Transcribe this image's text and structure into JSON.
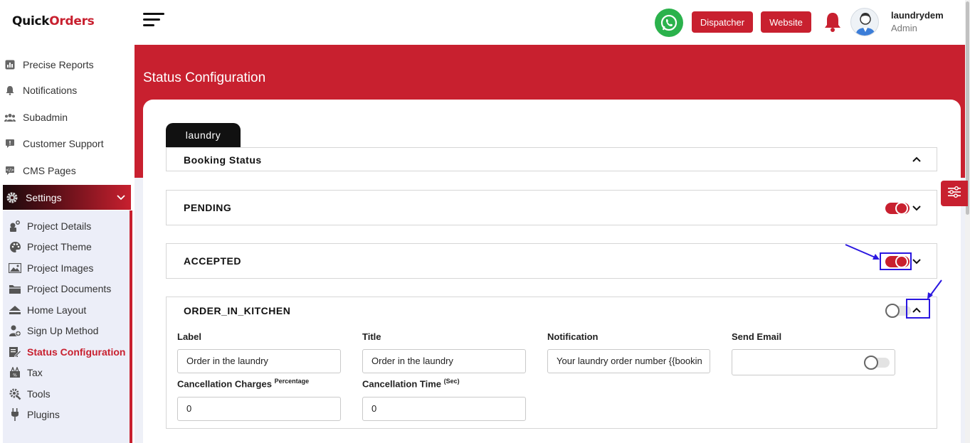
{
  "brand": {
    "logo_part1": "Quick",
    "logo_part2": "Orders"
  },
  "sidebar": {
    "items": [
      {
        "label": "Precise Reports",
        "icon": "chart-icon"
      },
      {
        "label": "Notifications",
        "icon": "bell-icon"
      },
      {
        "label": "Subadmin",
        "icon": "users-icon"
      },
      {
        "label": "Customer Support",
        "icon": "support-chat-icon"
      },
      {
        "label": "CMS Pages",
        "icon": "cms-chat-icon"
      }
    ],
    "settings_label": "Settings",
    "settings_expanded": true,
    "submenu": [
      {
        "label": "Project Details",
        "icon": "project-details-icon",
        "active": false
      },
      {
        "label": "Project Theme",
        "icon": "palette-icon",
        "active": false
      },
      {
        "label": "Project Images",
        "icon": "image-icon",
        "active": false
      },
      {
        "label": "Project Documents",
        "icon": "folder-icon",
        "active": false
      },
      {
        "label": "Home Layout",
        "icon": "home-icon",
        "active": false
      },
      {
        "label": "Sign Up Method",
        "icon": "user-plus-icon",
        "active": false
      },
      {
        "label": "Status Configuration",
        "icon": "status-config-icon",
        "active": true
      },
      {
        "label": "Tax",
        "icon": "tax-icon",
        "active": false
      },
      {
        "label": "Tools",
        "icon": "tools-icon",
        "active": false
      },
      {
        "label": "Plugins",
        "icon": "plug-icon",
        "active": false
      }
    ]
  },
  "header": {
    "dispatcher_label": "Dispatcher",
    "website_label": "Website",
    "user_name": "laundrydem",
    "user_role": "Admin"
  },
  "page": {
    "title": "Status Configuration",
    "tab_label": "laundry",
    "section_title": "Booking Status"
  },
  "statuses": {
    "pending": {
      "name": "PENDING",
      "enabled": true,
      "expanded": false
    },
    "accepted": {
      "name": "ACCEPTED",
      "enabled": true,
      "expanded": false
    },
    "order_in_kitchen": {
      "name": "ORDER_IN_KITCHEN",
      "enabled": false,
      "expanded": true,
      "label_heading": "Label",
      "label_value": "Order in the laundry",
      "title_heading": "Title",
      "title_value": "Order in the laundry",
      "notification_heading": "Notification",
      "notification_value": "Your laundry order number {{bookin",
      "send_email_heading": "Send Email",
      "send_email_enabled": false,
      "cancellation_charges_heading": "Cancellation Charges",
      "cancellation_charges_sup": "Percentage",
      "cancellation_charges_value": "0",
      "cancellation_time_heading": "Cancellation Time",
      "cancellation_time_sup": "(Sec)",
      "cancellation_time_value": "0"
    }
  },
  "colors": {
    "brand_red": "#c8202f",
    "annotation_blue": "#2a17e0",
    "whatsapp_green": "#2bb24c",
    "submenu_bg": "#eceef8"
  }
}
